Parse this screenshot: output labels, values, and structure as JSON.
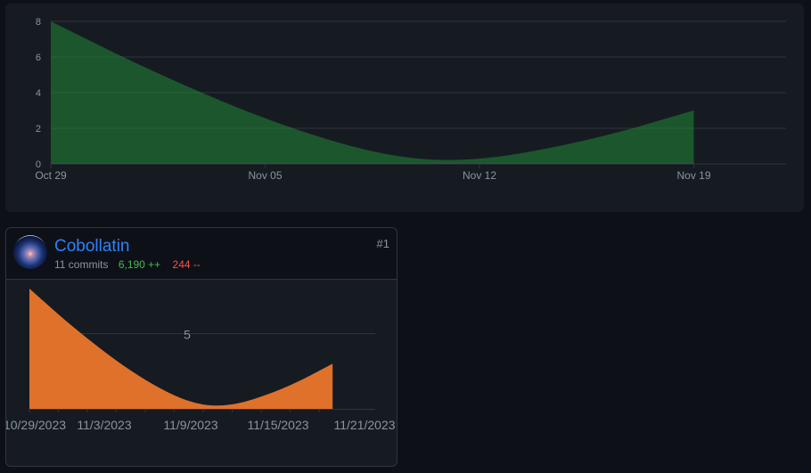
{
  "overview": {
    "chart_data": {
      "type": "area",
      "x": [
        "Oct 29",
        "Oct 30",
        "Oct 31",
        "Nov 01",
        "Nov 02",
        "Nov 03",
        "Nov 04",
        "Nov 05",
        "Nov 06",
        "Nov 07",
        "Nov 08",
        "Nov 09",
        "Nov 10",
        "Nov 11",
        "Nov 12",
        "Nov 13",
        "Nov 14",
        "Nov 15",
        "Nov 16",
        "Nov 17",
        "Nov 18",
        "Nov 19"
      ],
      "values": [
        8,
        7.15,
        6.3,
        5.48,
        4.7,
        3.95,
        3.23,
        2.56,
        1.95,
        1.4,
        0.92,
        0.54,
        0.3,
        0.22,
        0.3,
        0.5,
        0.8,
        1.15,
        1.55,
        2.0,
        2.5,
        3.0
      ],
      "x_ticks": [
        "Oct 29",
        "Nov 05",
        "Nov 12",
        "Nov 19"
      ],
      "y_ticks": [
        0,
        2,
        4,
        6,
        8
      ],
      "ylim": [
        0,
        8
      ],
      "grid": true,
      "color": "#238636"
    }
  },
  "contributor": {
    "name": "Cobollatin",
    "commits": "11 commits",
    "additions": "6,190 ++",
    "deletions": "244 --",
    "rank": "#1",
    "chart_data": {
      "type": "area",
      "x": [
        "10/29/2023",
        "10/30/2023",
        "10/31/2023",
        "11/1/2023",
        "11/2/2023",
        "11/3/2023",
        "11/4/2023",
        "11/5/2023",
        "11/6/2023",
        "11/7/2023",
        "11/8/2023",
        "11/9/2023",
        "11/10/2023",
        "11/11/2023",
        "11/12/2023",
        "11/13/2023",
        "11/14/2023",
        "11/15/2023",
        "11/16/2023",
        "11/17/2023",
        "11/18/2023",
        "11/19/2023"
      ],
      "values": [
        8,
        7.15,
        6.3,
        5.48,
        4.7,
        3.95,
        3.23,
        2.56,
        1.95,
        1.4,
        0.92,
        0.54,
        0.3,
        0.22,
        0.3,
        0.5,
        0.8,
        1.15,
        1.55,
        2.0,
        2.5,
        3.0
      ],
      "x_tick_labels": [
        "10/29/2023",
        "11/3/2023",
        "11/9/2023",
        "11/15/2023",
        "11/21/2023"
      ],
      "y_tick_labels": [
        "5"
      ],
      "ylim": [
        0,
        8
      ],
      "color": "#e0712b"
    }
  }
}
